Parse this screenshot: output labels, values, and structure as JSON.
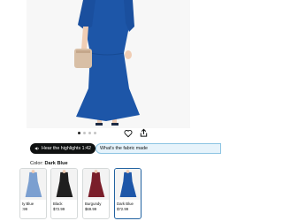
{
  "product_image": {
    "carousel_dots": 4,
    "active_dot": 1,
    "dress_color": "#1d56a8",
    "skin_color": "#f0cdb4",
    "bag_color": "#d8bfa6"
  },
  "actions": {
    "heart_icon": "heart-icon",
    "share_icon": "share-icon"
  },
  "highlights_button": {
    "label": "Hear the highlights 1:42",
    "icon": "speaker-icon"
  },
  "fabric_button": {
    "label": "What's the fabric made"
  },
  "color_selector": {
    "label": "Color:",
    "selected": "Dark Blue",
    "options": [
      {
        "name": "ty Blue",
        "price": ":99",
        "color": "#7b9fd0"
      },
      {
        "name": "Black",
        "price": "$72.99",
        "color": "#1f1f1f"
      },
      {
        "name": "Burgundy",
        "price": "$69.99",
        "color": "#7a1e2a"
      },
      {
        "name": "Dark Blue",
        "price": "$72.99",
        "color": "#1d56a8"
      }
    ]
  }
}
